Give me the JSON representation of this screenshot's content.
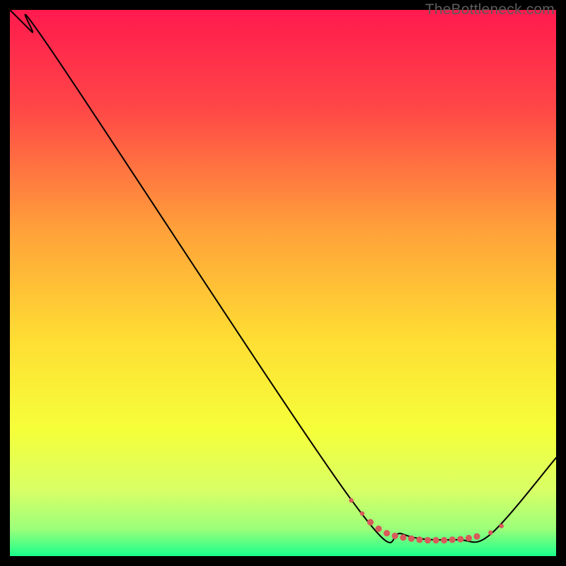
{
  "watermark": "TheBottleneck.com",
  "chart_data": {
    "type": "line",
    "title": "",
    "xlabel": "",
    "ylabel": "",
    "xlim": [
      0,
      100
    ],
    "ylim": [
      0,
      100
    ],
    "background_gradient": {
      "stops": [
        {
          "offset": 0,
          "color": "#ff1a4e"
        },
        {
          "offset": 18,
          "color": "#ff4747"
        },
        {
          "offset": 40,
          "color": "#ffa03a"
        },
        {
          "offset": 60,
          "color": "#ffdd33"
        },
        {
          "offset": 77,
          "color": "#f5ff3a"
        },
        {
          "offset": 88,
          "color": "#d8ff66"
        },
        {
          "offset": 95,
          "color": "#9cff7a"
        },
        {
          "offset": 100,
          "color": "#1aff8c"
        }
      ]
    },
    "series": [
      {
        "name": "bottleneck-curve",
        "color": "#000000",
        "x": [
          0,
          4,
          8,
          62,
          72,
          82,
          88,
          100
        ],
        "y": [
          100,
          96,
          92,
          11,
          4,
          3,
          4,
          18
        ]
      }
    ],
    "markers": {
      "name": "bottleneck-points",
      "color": "#d85a5a",
      "radius_small": 3.2,
      "radius_large": 4.6,
      "points": [
        {
          "x": 62.5,
          "y": 10.2,
          "r": "small"
        },
        {
          "x": 64.5,
          "y": 7.8,
          "r": "small"
        },
        {
          "x": 66.0,
          "y": 6.2,
          "r": "large"
        },
        {
          "x": 67.5,
          "y": 5.0,
          "r": "large"
        },
        {
          "x": 69.0,
          "y": 4.2,
          "r": "large"
        },
        {
          "x": 70.5,
          "y": 3.7,
          "r": "large"
        },
        {
          "x": 72.0,
          "y": 3.4,
          "r": "large"
        },
        {
          "x": 73.5,
          "y": 3.2,
          "r": "large"
        },
        {
          "x": 75.0,
          "y": 3.0,
          "r": "large"
        },
        {
          "x": 76.5,
          "y": 2.9,
          "r": "large"
        },
        {
          "x": 78.0,
          "y": 2.9,
          "r": "large"
        },
        {
          "x": 79.5,
          "y": 2.9,
          "r": "large"
        },
        {
          "x": 81.0,
          "y": 3.0,
          "r": "large"
        },
        {
          "x": 82.5,
          "y": 3.1,
          "r": "large"
        },
        {
          "x": 84.0,
          "y": 3.3,
          "r": "large"
        },
        {
          "x": 85.5,
          "y": 3.6,
          "r": "large"
        },
        {
          "x": 88.0,
          "y": 4.3,
          "r": "small"
        },
        {
          "x": 90.0,
          "y": 5.5,
          "r": "small"
        }
      ]
    }
  }
}
